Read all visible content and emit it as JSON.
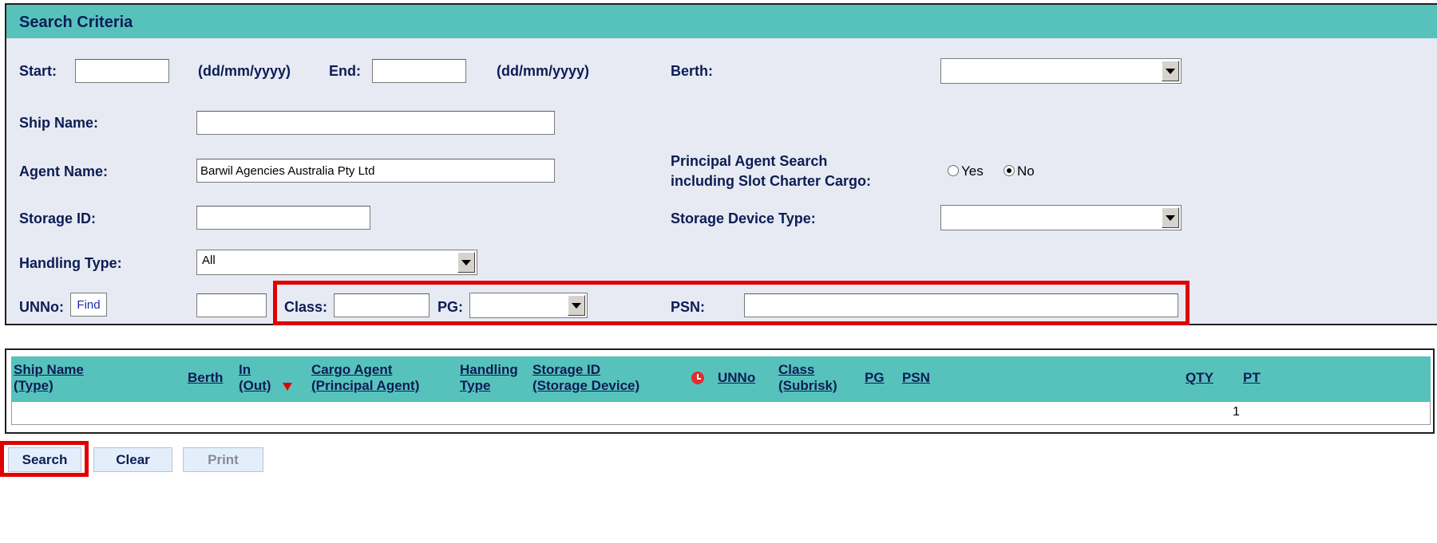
{
  "criteria": {
    "title": "Search Criteria",
    "start_label": "Start:",
    "start_value": "",
    "start_hint": "(dd/mm/yyyy)",
    "end_label": "End:",
    "end_value": "",
    "end_hint": "(dd/mm/yyyy)",
    "berth_label": "Berth:",
    "berth_value": "",
    "ship_name_label": "Ship Name:",
    "ship_name_value": "",
    "agent_name_label": "Agent Name:",
    "agent_name_value": "Barwil Agencies Australia Pty Ltd",
    "principal_label_1": "Principal Agent Search",
    "principal_label_2": "including Slot Charter Cargo:",
    "principal_yes": "Yes",
    "principal_no": "No",
    "principal_selected": "No",
    "storage_id_label": "Storage ID:",
    "storage_id_value": "",
    "storage_device_label": "Storage Device Type:",
    "storage_device_value": "",
    "handling_type_label": "Handling Type:",
    "handling_type_value": "All",
    "unno_label": "UNNo:",
    "find_label": "Find",
    "unno_value": "",
    "class_label": "Class:",
    "class_value": "",
    "pg_label": "PG:",
    "pg_value": "",
    "psn_label": "PSN:",
    "psn_value": ""
  },
  "results": {
    "columns": {
      "ship_1": "Ship Name",
      "ship_2": "(Type)",
      "berth": "Berth",
      "in_1": "In",
      "in_2": "(Out)",
      "agent_1": "Cargo Agent",
      "agent_2": "(Principal Agent)",
      "handling_1": "Handling",
      "handling_2": "Type",
      "storage_1": "Storage ID",
      "storage_2": "(Storage Device)",
      "unno": "UNNo",
      "class_1": "Class",
      "class_2": "(Subrisk)",
      "pg": "PG",
      "psn": "PSN",
      "qty": "QTY",
      "pt": "PT"
    },
    "row_count": "1"
  },
  "buttons": {
    "search": "Search",
    "clear": "Clear",
    "print": "Print"
  },
  "colors": {
    "header_teal": "#57c2bc",
    "panel_bg": "#e7eaf3",
    "label_navy": "#0c1d54",
    "highlight_red": "#e00000"
  }
}
